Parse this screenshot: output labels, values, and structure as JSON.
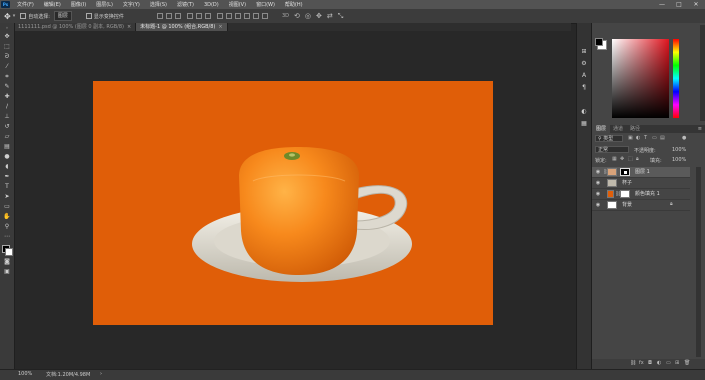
{
  "app": {
    "logo": "Ps"
  },
  "menu": {
    "items": [
      "文件(F)",
      "编辑(E)",
      "图像(I)",
      "图层(L)",
      "文字(Y)",
      "选择(S)",
      "滤镜(T)",
      "3D(D)",
      "视图(V)",
      "窗口(W)",
      "帮助(H)"
    ],
    "minimize": "—",
    "restore": "□",
    "close": "✕"
  },
  "options": {
    "auto_select_label": "自动选择:",
    "auto_select_value": "图层",
    "show_transform_label": "显示变换控件"
  },
  "tabs": [
    {
      "label": "1111111.psd @ 100% (图层 0 副本, RGB/8)",
      "close": "×"
    },
    {
      "label": "未标题-1 @ 100% (组合,RGB/8)",
      "close": "×"
    }
  ],
  "status": {
    "zoom": "100%",
    "doc_size": "文档:1.20M/4.98M",
    "arrow": "›"
  },
  "color_panel": {
    "colors": {
      "hue_top": "#ff0000",
      "saturated": "#e0141e"
    }
  },
  "layers_panel": {
    "tabs": [
      "图层",
      "通道",
      "路径"
    ],
    "kind_label": "类型",
    "blend_mode": "正常",
    "opacity_label": "不透明度:",
    "opacity_value": "100%",
    "lock_label": "锁定:",
    "fill_label": "填充:",
    "fill_value": "100%",
    "layers": [
      {
        "name": "图层 1"
      },
      {
        "name": "杯子"
      },
      {
        "name": "颜色填充 1"
      },
      {
        "name": "背景"
      }
    ]
  }
}
